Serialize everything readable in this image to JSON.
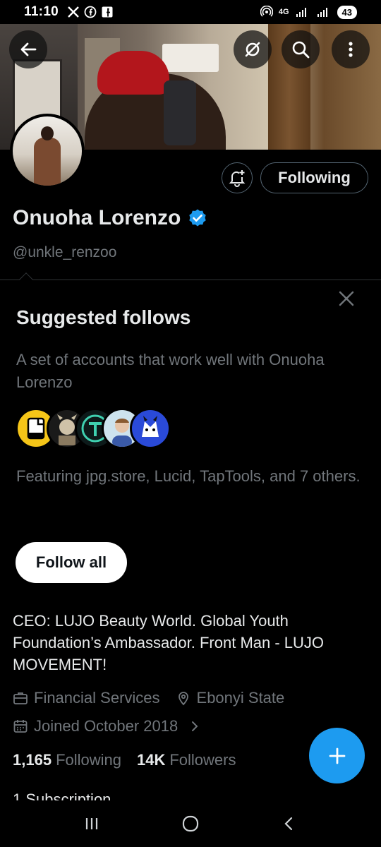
{
  "status_bar": {
    "time": "11:10",
    "network": "4G",
    "battery": "43"
  },
  "profile": {
    "name": "Onuoha Lorenzo",
    "handle": "@unkle_renzoo",
    "following_button": "Following",
    "bio": "CEO: LUJO Beauty World. Global Youth Foundation’s Ambassador. Front Man - LUJO MOVEMENT!",
    "category": "Financial Services",
    "location": "Ebonyi State",
    "joined": "Joined October 2018",
    "following_count": "1,165",
    "following_label": "Following",
    "followers_count": "14K",
    "followers_label": "Followers",
    "subscription_peek": "1 Subscription"
  },
  "suggested": {
    "title": "Suggested follows",
    "description": "A set of accounts that work well with Onuoha Lorenzo",
    "featuring": "Featuring jpg.store, Lucid, TapTools, and 7 others.",
    "follow_all": "Follow all"
  },
  "colors": {
    "accent": "#1d9bf0",
    "verified": "#1d9bf0",
    "muted": "#71767b",
    "background": "#000000"
  },
  "icons": [
    "back-arrow-icon",
    "no-signal-icon",
    "search-icon",
    "more-icon",
    "bell-plus-icon",
    "verified-icon",
    "close-icon",
    "briefcase-icon",
    "location-icon",
    "calendar-icon",
    "chevron-right-icon",
    "plus-icon"
  ]
}
